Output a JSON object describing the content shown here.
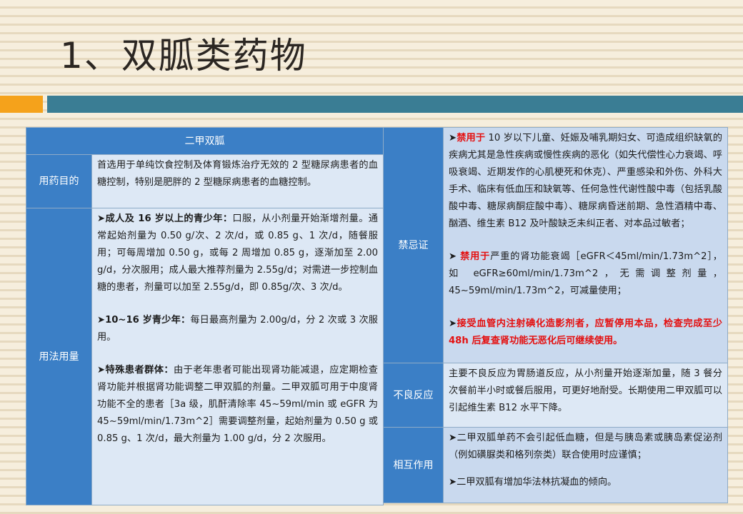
{
  "page": {
    "title": "1、双胍类药物"
  },
  "left_table": {
    "header": "二甲双胍",
    "purpose": {
      "label": "用药目的",
      "text": "首选用于单纯饮食控制及体育锻炼治疗无效的 2 型糖尿病患者的血糖控制，特别是肥胖的 2 型糖尿病患者的血糖控制。"
    },
    "usage": {
      "label": "用法用量",
      "p1_arrow": "➤",
      "p1_head": "成人及 16 岁以上的青少年：",
      "p1_text": "口服，从小剂量开始渐增剂量。通常起始剂量为 0.50 g/次、2 次/d，或 0.85 g、1 次/d，随餐服用；可每周增加 0.50 g，或每 2 周增加 0.85 g，逐渐加至 2.00 g/d，分次服用；成人最大推荐剂量为 2.55g/d；对需进一步控制血糖的患者，剂量可以加至 2.55g/d，即 0.85g/次、3 次/d。",
      "p2_arrow": "➤",
      "p2_head": "10~16 岁青少年：",
      "p2_text": "每日最高剂量为 2.00g/d，分 2 次或 3 次服用。",
      "p3_arrow": "➤",
      "p3_head": "特殊患者群体：",
      "p3_text": "由于老年患者可能出现肾功能减退，应定期检查肾功能并根据肾功能调整二甲双胍的剂量。二甲双胍可用于中度肾功能不全的患者［3a 级，肌酐清除率 45~59ml/min 或 eGFR 为 45~59ml/min/1.73m^2］需要调整剂量，起始剂量为 0.50 g 或 0.85 g、1 次/d，最大剂量为 1.00 g/d，分 2 次服用。"
    }
  },
  "right_table": {
    "contra": {
      "label": "禁忌证",
      "c1_arrow": "➤",
      "c1_red": "禁用于",
      "c1_text": " 10 岁以下儿童、妊娠及哺乳期妇女、可造成组织缺氧的疾病尤其是急性疾病或慢性疾病的恶化（如失代偿性心力衰竭、呼吸衰竭、近期发作的心肌梗死和休克）、严重感染和外伤、外科大手术、临床有低血压和缺氧等、任何急性代谢性酸中毒（包括乳酸酸中毒、糖尿病酮症酸中毒）、糖尿病昏迷前期、急性酒精中毒、酗酒、维生素 B12 及叶酸缺乏未纠正者、对本品过敏者；",
      "c2_arrow": "➤",
      "c2_red": "禁用于",
      "c2_text": "严重的肾功能衰竭［eGFR＜45ml/min/1.73m^2］，如 eGFR≥60ml/min/1.73m^2，无需调整剂量，45~59ml/min/1.73m^2，可减量使用；",
      "c3_arrow": "➤",
      "c3_text": "接受血管内注射碘化造影剂者，应暂停用本品，检查完成至少 48h 后复查肾功能无恶化后可继续使用。"
    },
    "adverse": {
      "label": "不良反应",
      "text": "主要不良反应为胃肠道反应，从小剂量开始逐渐加量，随 3 餐分次餐前半小时或餐后服用，可更好地耐受。长期使用二甲双胍可以引起维生素 B12 水平下降。"
    },
    "interaction": {
      "label": "相互作用",
      "i1_arrow": "➤",
      "i1_text": "二甲双胍单药不会引起低血糖，但是与胰岛素或胰岛素促泌剂（例如磺脲类和格列奈类）联合使用时应谨慎；",
      "i2_arrow": "➤",
      "i2_text": "二甲双胍有增加华法林抗凝血的倾向。"
    }
  },
  "colors": {
    "header_blue": "#3b7fc6",
    "cell_light": "#dde8f5",
    "accent_orange": "#f5a21b",
    "accent_teal": "#3a7d94",
    "warning_red": "#e41010"
  }
}
